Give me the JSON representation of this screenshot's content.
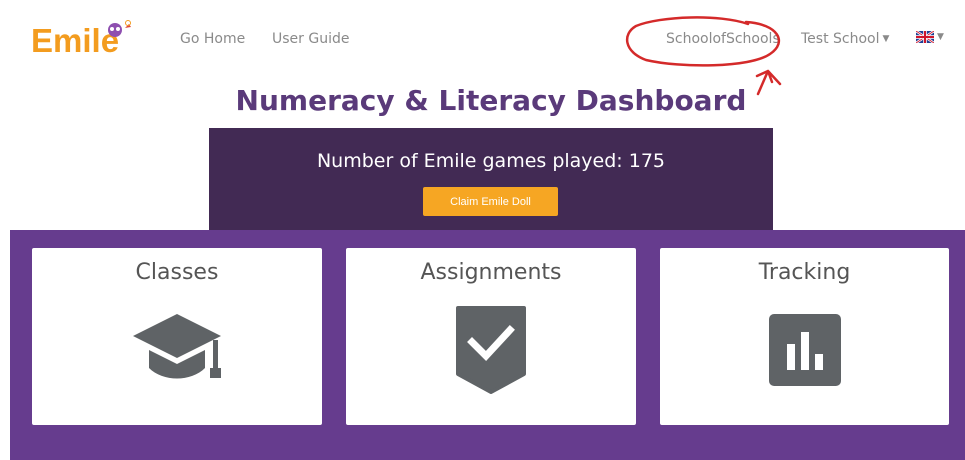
{
  "header": {
    "logo_text": "Emile",
    "nav": {
      "home": "Go Home",
      "guide": "User Guide",
      "school_group": "SchoolofSchools",
      "school": "Test School",
      "language_icon": "uk-flag-icon"
    }
  },
  "page_title": "Numeracy & Literacy Dashboard",
  "games": {
    "text": "Number of Emile games played: 175",
    "claim_label": "Claim Emile Doll"
  },
  "cards": [
    {
      "label": "Classes",
      "icon": "graduation-cap-icon"
    },
    {
      "label": "Assignments",
      "icon": "checkmark-badge-icon"
    },
    {
      "label": "Tracking",
      "icon": "bar-chart-icon"
    }
  ],
  "colors": {
    "brand_orange": "#f39c1f",
    "title_purple": "#5a3a7a",
    "banner_dark": "#422a54",
    "band_purple": "#663c8e",
    "button_orange": "#f6a623",
    "icon_gray": "#5f6366",
    "annotation_red": "#d42a2a"
  }
}
